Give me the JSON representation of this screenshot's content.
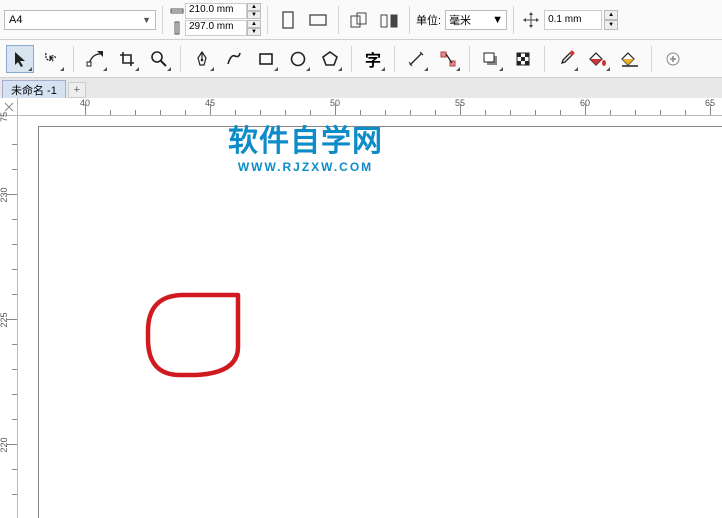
{
  "toolbar": {
    "page_size": "A4",
    "width": "210.0 mm",
    "height": "297.0 mm",
    "unit_label": "单位:",
    "unit_value": "毫米",
    "nudge": "0.1 mm"
  },
  "tools": {
    "names": [
      "pick",
      "freehand-pick",
      "shape-edit",
      "crop",
      "zoom",
      "pen",
      "curve",
      "rectangle",
      "ellipse",
      "polygon",
      "text",
      "line",
      "connector",
      "drop-shadow",
      "transparency",
      "eyedropper",
      "fill",
      "outline"
    ]
  },
  "tab": {
    "name": "未命名 -1"
  },
  "ruler": {
    "h_labels": [
      "40",
      "45",
      "50",
      "55",
      "60",
      "65"
    ],
    "v_labels": [
      "75",
      "230",
      "225",
      "220"
    ]
  },
  "watermark": {
    "title": "软件自学网",
    "url": "WWW.RJZXW.COM"
  }
}
